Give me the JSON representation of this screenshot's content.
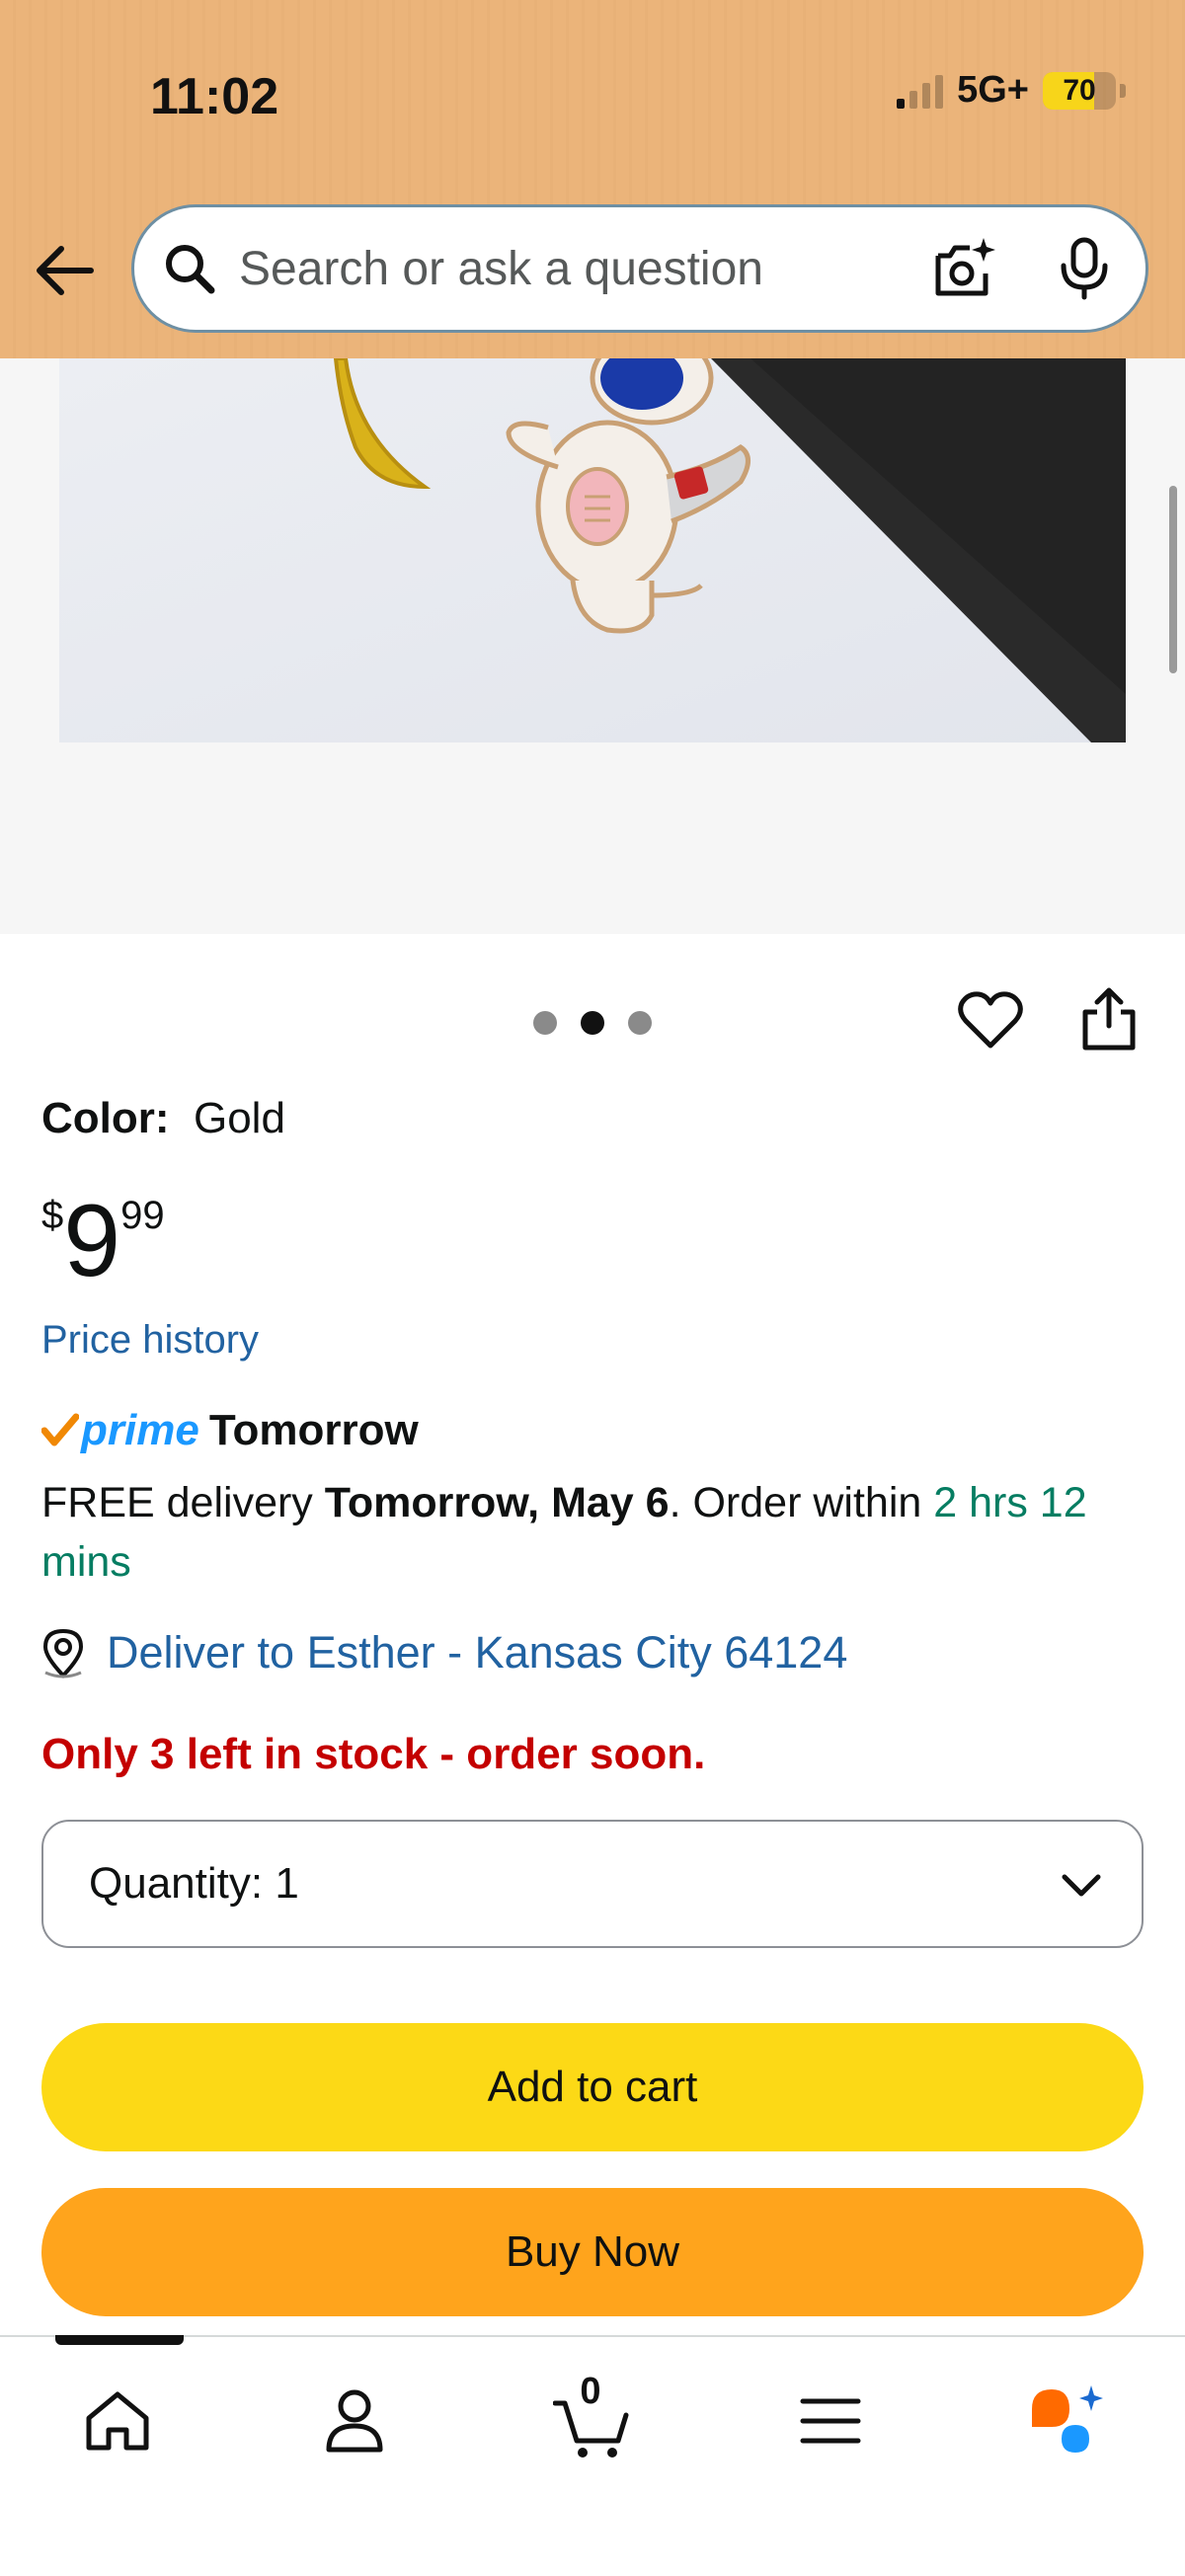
{
  "status_bar": {
    "time": "11:02",
    "network": "5G+",
    "battery": "70",
    "battery_level": 0.7,
    "battery_color": "#f7d51a"
  },
  "search": {
    "placeholder": "Search or ask a question",
    "back_icon": "back-arrow-icon",
    "search_icon": "search-icon",
    "camera_icon": "camera-sparkle-icon",
    "mic_icon": "microphone-icon"
  },
  "gallery": {
    "image_count": 3,
    "active_index": 1
  },
  "product": {
    "color_label": "Color:",
    "color_value": "Gold",
    "price_symbol": "$",
    "price_whole": "9",
    "price_fraction": "99",
    "price_history": "Price history",
    "prime_word": "prime",
    "prime_day": "Tomorrow",
    "delivery_prefix": "FREE delivery ",
    "delivery_date": "Tomorrow, May 6",
    "delivery_middle": ". Order within ",
    "delivery_countdown": "2 hrs 12 mins",
    "deliver_to": "Deliver to Esther - Kansas City 64124",
    "stock_message": "Only 3 left in stock - order soon."
  },
  "quantity": {
    "label": "Quantity:",
    "value": "1"
  },
  "buttons": {
    "add_to_cart": "Add to cart",
    "buy_now": "Buy Now"
  },
  "nav": {
    "cart_count": "0",
    "items": [
      "home-icon",
      "account-icon",
      "cart-icon",
      "menu-icon",
      "rufus-ai-icon"
    ]
  },
  "colors": {
    "link_blue": "#2162a1",
    "stock_red": "#c40000",
    "countdown_green": "#067d62",
    "add_to_cart_yellow": "#fcd916",
    "buy_now_orange": "#ffa41c",
    "prime_blue": "#1a98ff",
    "header_bg": "#ebb47a"
  }
}
